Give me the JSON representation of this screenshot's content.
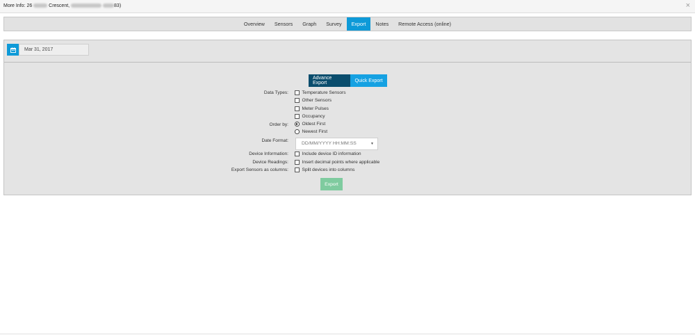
{
  "header": {
    "title_prefix": "More Info: 26",
    "title_middle": "Crescent,",
    "title_suffix": "83)",
    "close_glyph": "×"
  },
  "tabs": [
    {
      "label": "Overview",
      "active": false
    },
    {
      "label": "Sensors",
      "active": false
    },
    {
      "label": "Graph",
      "active": false
    },
    {
      "label": "Survey",
      "active": false
    },
    {
      "label": "Export",
      "active": true
    },
    {
      "label": "Notes",
      "active": false
    },
    {
      "label": "Remote Access (online)",
      "active": false
    }
  ],
  "date_picker": {
    "value": "Mar 31, 2017",
    "icon": "calendar-icon"
  },
  "mode_toggle": {
    "advanced": "Advance Export",
    "quick": "Quick Export",
    "selected": "advanced"
  },
  "form": {
    "data_types": {
      "label": "Data Types:",
      "options": [
        {
          "label": "Temperature Sensors",
          "checked": false
        },
        {
          "label": "Other Sensors",
          "checked": false
        },
        {
          "label": "Meter Pulses",
          "checked": false
        },
        {
          "label": "Occupancy",
          "checked": false
        }
      ]
    },
    "order_by": {
      "label": "Order by:",
      "options": [
        {
          "label": "Oldest First",
          "selected": true
        },
        {
          "label": "Newest First",
          "selected": false
        }
      ]
    },
    "date_format": {
      "label": "Date Format:",
      "value": "DD/MM/YYYY HH:MM:SS"
    },
    "device_information": {
      "label": "Device Information:",
      "option": "Include device ID information",
      "checked": false
    },
    "device_readings": {
      "label": "Device Readings:",
      "option": "Insert decimal points where applicable",
      "checked": false
    },
    "export_sensors": {
      "label": "Export Sensors as columns:",
      "option": "Split devices into columns",
      "checked": false
    }
  },
  "export_button": {
    "label": "Export"
  },
  "colors": {
    "accent": "#0e9ad8",
    "advanced_dark": "#0a4d6d",
    "export_green": "#7fcb9f",
    "panel_bg": "#e4e4e4"
  }
}
